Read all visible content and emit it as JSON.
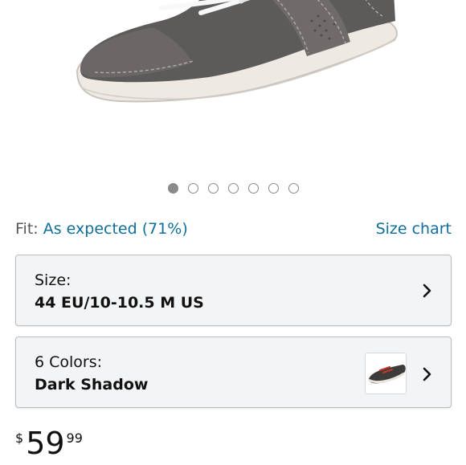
{
  "product_image": {
    "alt_icon": "sneaker-photo",
    "shoe_upper_color": "#5d5b5a",
    "sole_color": "#eeeae3",
    "lace_color": "#f8f8f8"
  },
  "carousel": {
    "total": 7,
    "active_index": 0
  },
  "fit": {
    "label": "Fit:",
    "value": "As expected (71%)",
    "size_chart_link": "Size chart"
  },
  "size_selector": {
    "label": "Size:",
    "value": "44 EU/10-10.5 M US"
  },
  "color_selector": {
    "label": "6 Colors:",
    "value": "Dark Shadow"
  },
  "price": {
    "currency_symbol": "$",
    "whole": "59",
    "fraction": "99"
  },
  "colors": {
    "link": "#0f6e9c",
    "selector_bg": "#f3f4f5",
    "selector_border": "#b9bcbd"
  }
}
